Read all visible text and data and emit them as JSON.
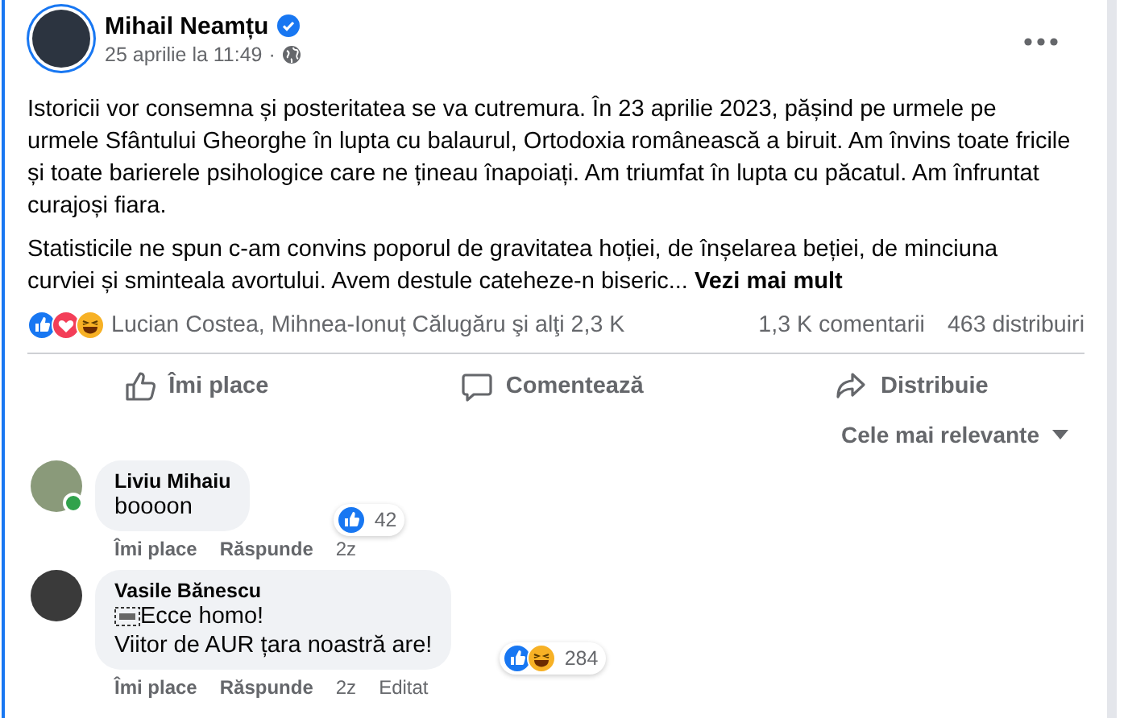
{
  "post": {
    "author": "Mihail Neamțu",
    "verified": true,
    "date": "25 aprilie la 11:49",
    "separator": "·",
    "paragraphs": [
      "Istoricii vor consemna și posteritatea se va cutremura. În 23 aprilie 2023, pășind pe urmele pe urmele Sfântului Gheorghe în lupta cu balaurul, Ortodoxia românească a biruit. Am învins toate fricile și toate barierele psihologice care ne țineau înapoiați. Am triumfat în lupta cu păcatul. Am înfruntat curajoși fiara.",
      "Statisticile ne spun c-am convins poporul de gravitatea hoției, de înșelarea beției, de minciuna curviei și sminteala avortului. Avem destule cateheze-n biseric..."
    ],
    "see_more": "Vezi mai mult",
    "reactions": [
      {
        "kind": "like"
      },
      {
        "kind": "love"
      },
      {
        "kind": "haha"
      }
    ],
    "reactors": "Lucian Costea, Mihnea-Ionuț Călugăru şi alţi 2,3 K",
    "comments_count": "1,3 K comentarii",
    "shares_count": "463 distribuiri",
    "actions": [
      {
        "kind": "like",
        "label": "Îmi place"
      },
      {
        "kind": "comment",
        "label": "Comentează"
      },
      {
        "kind": "share",
        "label": "Distribuie"
      }
    ]
  },
  "sort": {
    "label": "Cele mai relevante"
  },
  "comments": [
    {
      "author": "Liviu Mihaiu",
      "online": true,
      "object_glyph": false,
      "lines": [
        "boooon"
      ],
      "reactions": [
        {
          "kind": "like"
        }
      ],
      "reaction_count": "42",
      "actions": [
        "Îmi place",
        "Răspunde"
      ],
      "time": "2z"
    },
    {
      "author": "Vasile Bănescu",
      "online": false,
      "object_glyph": true,
      "lines": [
        "Ecce homo!",
        "Viitor de AUR țara noastră are!"
      ],
      "reactions": [
        {
          "kind": "like"
        },
        {
          "kind": "haha"
        }
      ],
      "reaction_count": "284",
      "actions": [
        "Îmi place",
        "Răspunde"
      ],
      "time": "2z",
      "edited": "Editat"
    }
  ]
}
